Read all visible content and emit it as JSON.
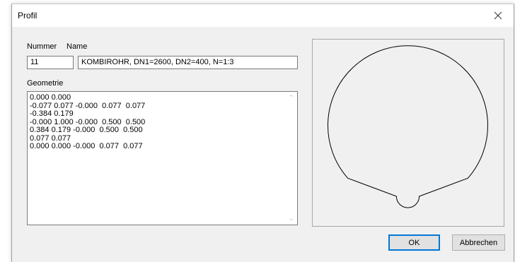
{
  "window": {
    "title": "Profil"
  },
  "form": {
    "nummer_label": "Nummer",
    "name_label": "Name",
    "nummer_value": "11",
    "name_value": "KOMBIROHR, DN1=2600,  DN2=400,  N=1:3",
    "geometrie_label": "Geometrie",
    "geometrie_lines": [
      "0.000 0.000",
      "-0.077 0.077 -0.000  0.077  0.077",
      "-0.384 0.179",
      "-0.000 1.000 -0.000  0.500  0.500",
      "0.384 0.179 -0.000  0.500  0.500",
      "0.077 0.077",
      "0.000 0.000 -0.000  0.077  0.077"
    ]
  },
  "buttons": {
    "ok": "OK",
    "cancel": "Abbrechen"
  },
  "icons": {
    "close": "close-icon",
    "scroll_up": "scroll-up-arrow-icon",
    "scroll_down": "scroll-down-arrow-icon"
  },
  "colors": {
    "window_bg": "#f0f0f0",
    "default_button_border": "#0078d7"
  }
}
